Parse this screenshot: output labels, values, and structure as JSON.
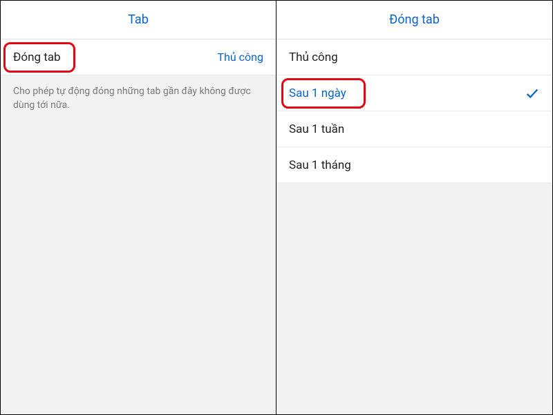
{
  "left": {
    "header_title": "Tab",
    "row_label": "Đóng tab",
    "row_value": "Thủ công",
    "description": "Cho phép tự động đóng những tab gần đây không được dùng tới nữa."
  },
  "right": {
    "header_title": "Đóng tab",
    "options": [
      {
        "label": "Thủ công",
        "selected": false
      },
      {
        "label": "Sau 1 ngày",
        "selected": true
      },
      {
        "label": "Sau 1 tuần",
        "selected": false
      },
      {
        "label": "Sau 1 tháng",
        "selected": false
      }
    ]
  }
}
